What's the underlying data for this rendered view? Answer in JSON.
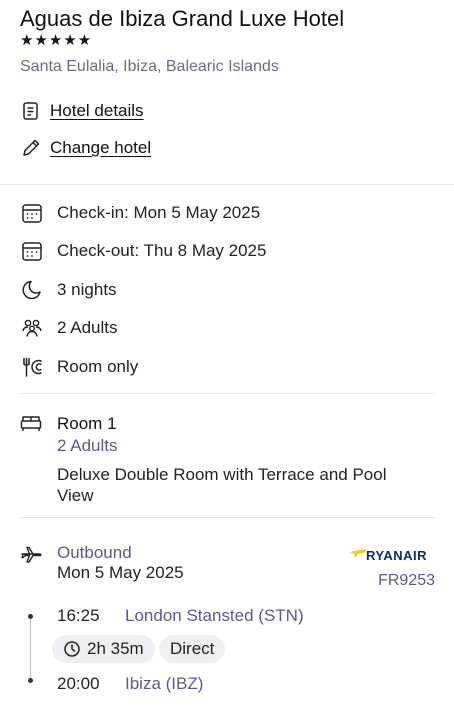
{
  "hotel": {
    "name": "Aguas de Ibiza Grand Luxe Hotel",
    "stars": "★★★★★",
    "star_rating": 5,
    "location": "Santa Eulalia, Ibiza, Balearic Islands"
  },
  "links": {
    "hotel_details": "Hotel details",
    "change_hotel": "Change hotel"
  },
  "details": {
    "check_in": "Check-in: Mon 5 May 2025",
    "check_out": "Check-out: Thu 8 May 2025",
    "nights": "3 nights",
    "guests": "2 Adults",
    "board": "Room only"
  },
  "room": {
    "title": "Room 1",
    "adults": "2 Adults",
    "description": "Deluxe Double Room with Terrace and Pool View"
  },
  "flight": {
    "direction": "Outbound",
    "date": "Mon 5 May 2025",
    "airline": "RYANAIR",
    "flight_number": "FR9253",
    "departure_time": "16:25",
    "departure_airport": "London Stansted (STN)",
    "duration": "2h 35m",
    "stops": "Direct",
    "arrival_time": "20:00",
    "arrival_airport": "Ibiza (IBZ)"
  },
  "colors": {
    "text": "#1a1a1a",
    "muted": "#5a5a8a",
    "divider": "#e3e3e3",
    "pill_bg": "#efeff3",
    "airline_blue": "#0b2a6f",
    "airline_yellow": "#f1c933"
  },
  "icons": [
    "document-icon",
    "pencil-icon",
    "calendar-icon",
    "moon-icon",
    "people-icon",
    "fork-plate-icon",
    "bed-icon",
    "plane-icon",
    "clock-icon",
    "harp-icon"
  ]
}
